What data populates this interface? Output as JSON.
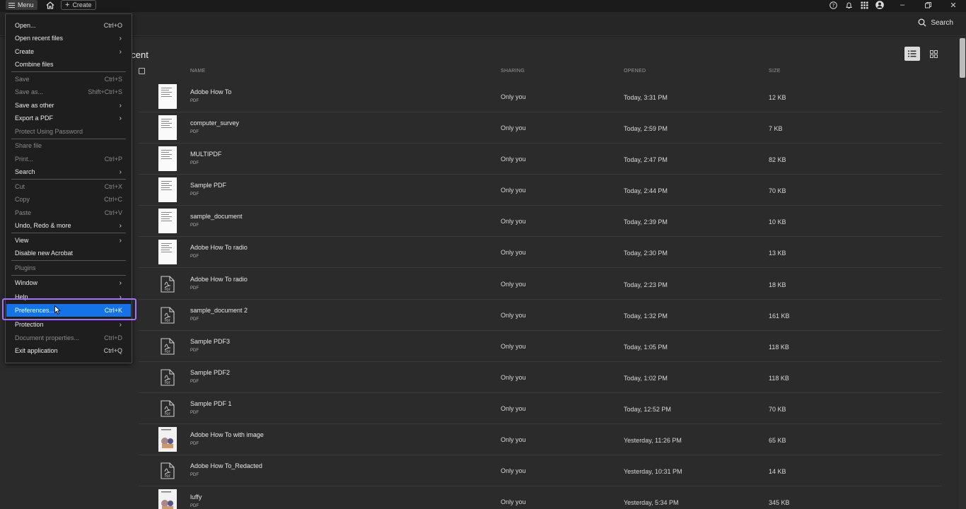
{
  "titlebar": {
    "menu_label": "Menu",
    "create_label": "Create"
  },
  "header": {
    "search_label": "Search"
  },
  "page": {
    "title": "Recent",
    "title_visible": "ecent"
  },
  "columns": {
    "name": "NAME",
    "sharing": "SHARING",
    "opened": "OPENED",
    "size": "SIZE"
  },
  "files": [
    {
      "name": "Adobe How To",
      "type": "PDF",
      "sharing": "Only you",
      "opened": "Today, 3:31 PM",
      "size": "12 KB",
      "thumb": "page"
    },
    {
      "name": "computer_survey",
      "type": "PDF",
      "sharing": "Only you",
      "opened": "Today, 2:59 PM",
      "size": "7 KB",
      "thumb": "page"
    },
    {
      "name": "MULTIPDF",
      "type": "PDF",
      "sharing": "Only you",
      "opened": "Today, 2:47 PM",
      "size": "82 KB",
      "thumb": "page"
    },
    {
      "name": "Sample PDF",
      "type": "PDF",
      "sharing": "Only you",
      "opened": "Today, 2:44 PM",
      "size": "70 KB",
      "thumb": "page"
    },
    {
      "name": "sample_document",
      "type": "PDF",
      "sharing": "Only you",
      "opened": "Today, 2:39 PM",
      "size": "10 KB",
      "thumb": "page"
    },
    {
      "name": "Adobe How To radio",
      "type": "PDF",
      "sharing": "Only you",
      "opened": "Today, 2:30 PM",
      "size": "13 KB",
      "thumb": "page"
    },
    {
      "name": "Adobe How To radio",
      "type": "PDF",
      "sharing": "Only you",
      "opened": "Today, 2:23 PM",
      "size": "18 KB",
      "thumb": "pdficon"
    },
    {
      "name": "sample_document 2",
      "type": "PDF",
      "sharing": "Only you",
      "opened": "Today, 1:32 PM",
      "size": "161 KB",
      "thumb": "pdficon"
    },
    {
      "name": "Sample PDF3",
      "type": "PDF",
      "sharing": "Only you",
      "opened": "Today, 1:05 PM",
      "size": "118 KB",
      "thumb": "pdficon"
    },
    {
      "name": "Sample PDF2",
      "type": "PDF",
      "sharing": "Only you",
      "opened": "Today, 1:02 PM",
      "size": "118 KB",
      "thumb": "pdficon"
    },
    {
      "name": "Sample PDF 1",
      "type": "PDF",
      "sharing": "Only you",
      "opened": "Today, 12:52 PM",
      "size": "70 KB",
      "thumb": "pdficon"
    },
    {
      "name": "Adobe How To with image",
      "type": "PDF",
      "sharing": "Only you",
      "opened": "Yesterday, 11:26 PM",
      "size": "65 KB",
      "thumb": "img"
    },
    {
      "name": "Adobe How To_Redacted",
      "type": "PDF",
      "sharing": "Only you",
      "opened": "Yesterday, 10:31 PM",
      "size": "14 KB",
      "thumb": "pdficon"
    },
    {
      "name": "luffy",
      "type": "PDF",
      "sharing": "Only you",
      "opened": "Yesterday, 5:34 PM",
      "size": "345 KB",
      "thumb": "img"
    }
  ],
  "menu": {
    "open": {
      "label": "Open...",
      "shortcut": "Ctrl+O"
    },
    "open_recent": {
      "label": "Open recent files"
    },
    "create": {
      "label": "Create"
    },
    "combine": {
      "label": "Combine files"
    },
    "save": {
      "label": "Save",
      "shortcut": "Ctrl+S"
    },
    "save_as": {
      "label": "Save as...",
      "shortcut": "Shift+Ctrl+S"
    },
    "save_as_other": {
      "label": "Save as other"
    },
    "export_pdf": {
      "label": "Export a PDF"
    },
    "protect_password": {
      "label": "Protect Using Password"
    },
    "share_file": {
      "label": "Share file"
    },
    "print": {
      "label": "Print...",
      "shortcut": "Ctrl+P"
    },
    "search": {
      "label": "Search"
    },
    "cut": {
      "label": "Cut",
      "shortcut": "Ctrl+X"
    },
    "copy": {
      "label": "Copy",
      "shortcut": "Ctrl+C"
    },
    "paste": {
      "label": "Paste",
      "shortcut": "Ctrl+V"
    },
    "undo_redo": {
      "label": "Undo, Redo & more"
    },
    "view": {
      "label": "View"
    },
    "disable_new": {
      "label": "Disable new Acrobat"
    },
    "plugins": {
      "label": "Plugins"
    },
    "window": {
      "label": "Window"
    },
    "help": {
      "label": "Help"
    },
    "preferences": {
      "label": "Preferences...",
      "shortcut": "Ctrl+K"
    },
    "protection": {
      "label": "Protection"
    },
    "doc_properties": {
      "label": "Document properties...",
      "shortcut": "Ctrl+D"
    },
    "exit": {
      "label": "Exit application",
      "shortcut": "Ctrl+Q"
    }
  },
  "colors": {
    "highlight": "#1473e6",
    "annotation_box": "#a970ff",
    "background": "#2b2b2b"
  }
}
